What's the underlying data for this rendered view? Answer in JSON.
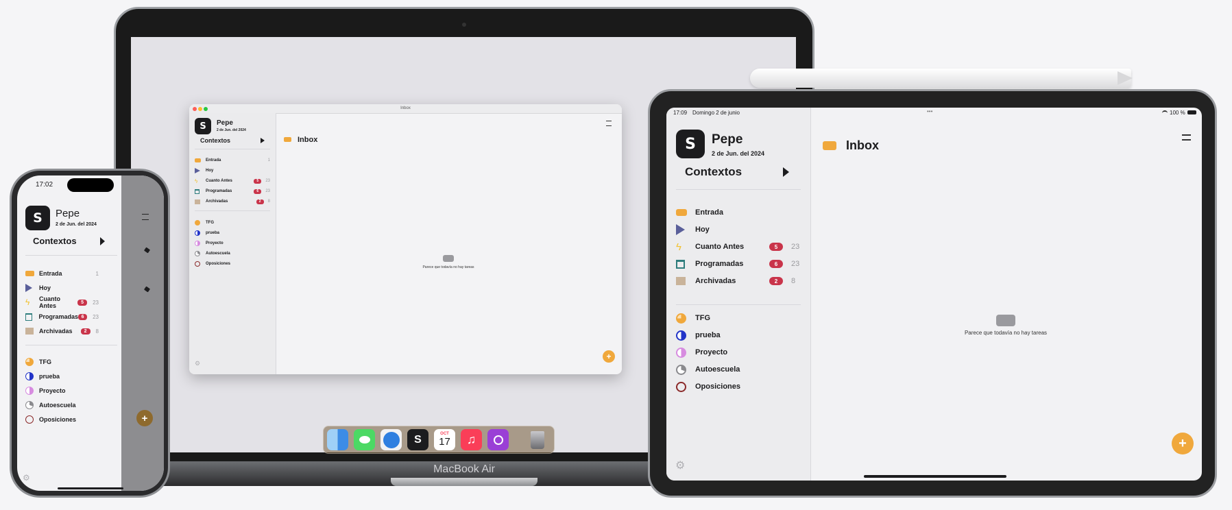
{
  "app": {
    "user_name": "Pepe",
    "user_date": "2 de Jun. del 2024",
    "contexts_label": "Contextos",
    "section_title": "Inbox",
    "empty_message": "Parece que todavía no hay tareas",
    "accent_color": "#f0a83c",
    "badge_color": "#c9344a",
    "logo_glyph": "S",
    "add_glyph": "+",
    "smart_lists": [
      {
        "label": "Entrada",
        "icon": "inbox-tray-icon",
        "badge": "",
        "count": "1"
      },
      {
        "label": "Hoy",
        "icon": "play-triangle-icon",
        "badge": "",
        "count": ""
      },
      {
        "label": "Cuanto Antes",
        "icon": "lightning-bolt-icon",
        "badge": "5",
        "count": "23"
      },
      {
        "label": "Programadas",
        "icon": "calendar-icon",
        "badge": "6",
        "count": "23"
      },
      {
        "label": "Archivadas",
        "icon": "archive-box-icon",
        "badge": "2",
        "count": "8"
      }
    ],
    "projects": [
      {
        "label": "TFG",
        "icon": "progress-circle-icon",
        "color": "#f0a83c"
      },
      {
        "label": "prueba",
        "icon": "half-circle-icon",
        "color": "#2234c8"
      },
      {
        "label": "Proyecto",
        "icon": "half-circle-icon",
        "color": "#d78ce0"
      },
      {
        "label": "Autoescuela",
        "icon": "progress-circle-icon",
        "color": "#8a8a8e"
      },
      {
        "label": "Oposiciones",
        "icon": "empty-circle-icon",
        "color": "#8b2a2a"
      }
    ]
  },
  "mac": {
    "window_title": "Inbox",
    "device_label": "MacBook Air",
    "dock_items": [
      {
        "name": "finder-icon",
        "color": "#3c8ce6",
        "glyph": ""
      },
      {
        "name": "messages-icon",
        "color": "#4cd964",
        "glyph": ""
      },
      {
        "name": "safari-icon",
        "color": "#2f7fe0",
        "glyph": ""
      },
      {
        "name": "app-icon",
        "color": "#1c1c1e",
        "glyph": "S"
      },
      {
        "name": "calendar-app-icon",
        "color": "#ffffff",
        "glyph": "17"
      },
      {
        "name": "music-icon",
        "color": "#fa3e58",
        "glyph": "♫"
      },
      {
        "name": "podcasts-icon",
        "color": "#9a3fd6",
        "glyph": ""
      },
      {
        "name": "trash-icon",
        "color": "#8d8d90",
        "glyph": ""
      }
    ],
    "calendar_month": "OCT"
  },
  "iphone": {
    "time": "17:02"
  },
  "ipad": {
    "time": "17:09",
    "date": "Domingo 2 de junio",
    "battery": "100 %",
    "more_dots": "•••"
  }
}
